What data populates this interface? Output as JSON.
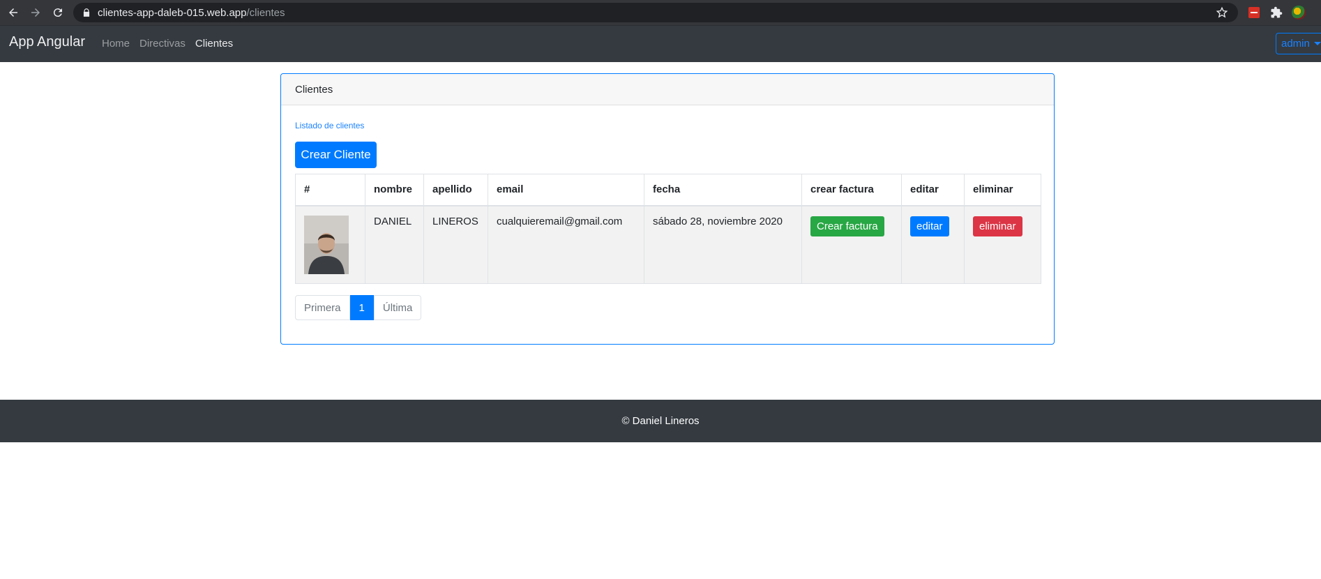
{
  "browser": {
    "url_host": "clientes-app-daleb-015.web.app",
    "url_path": "/clientes"
  },
  "navbar": {
    "brand": "App Angular",
    "links": [
      {
        "label": "Home",
        "active": false
      },
      {
        "label": "Directivas",
        "active": false
      },
      {
        "label": "Clientes",
        "active": true
      }
    ],
    "user_menu": "admin"
  },
  "card": {
    "header": "Clientes",
    "subtitle": "Listado de clientes",
    "create_button": "Crear Cliente"
  },
  "table": {
    "columns": [
      "#",
      "nombre",
      "apellido",
      "email",
      "fecha",
      "crear factura",
      "editar",
      "eliminar"
    ],
    "rows": [
      {
        "nombre": "DANIEL",
        "apellido": "LINEROS",
        "email": "cualquieremail@gmail.com",
        "fecha": "sábado 28, noviembre 2020",
        "crear_factura": "Crear factura",
        "editar": "editar",
        "eliminar": "eliminar"
      }
    ]
  },
  "pagination": {
    "first": "Primera",
    "current": "1",
    "last": "Última"
  },
  "footer": {
    "text": "© Daniel Lineros"
  },
  "colors": {
    "primary": "#007bff",
    "success": "#28a745",
    "danger": "#dc3545",
    "navbar": "#343a40"
  }
}
